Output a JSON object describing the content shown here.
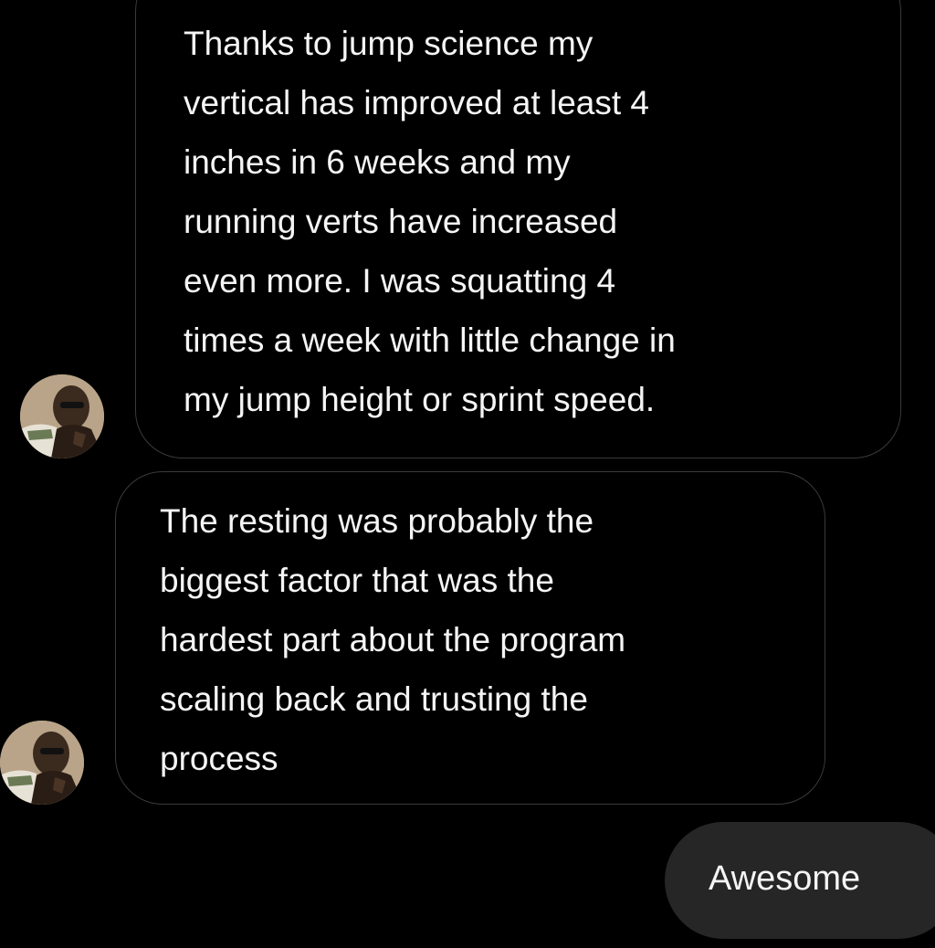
{
  "messages": [
    {
      "direction": "incoming",
      "lines": [
        "Thanks to jump science my",
        "vertical has improved at least 4",
        "inches in 6 weeks and my",
        "running verts have increased",
        "even more. I was squatting 4",
        "times a week with little change in",
        "my jump height or sprint speed."
      ]
    },
    {
      "direction": "incoming",
      "lines": [
        "The resting was probably the",
        "biggest factor that was the",
        "hardest part about the program",
        "scaling back and trusting the",
        "process"
      ]
    },
    {
      "direction": "outgoing",
      "text": "Awesome"
    }
  ],
  "avatar_icon": "user-photo-avatar",
  "colors": {
    "background": "#000000",
    "incoming_border": "#3a3a3a",
    "outgoing_bubble": "#262626",
    "text": "#f5f5f5"
  }
}
